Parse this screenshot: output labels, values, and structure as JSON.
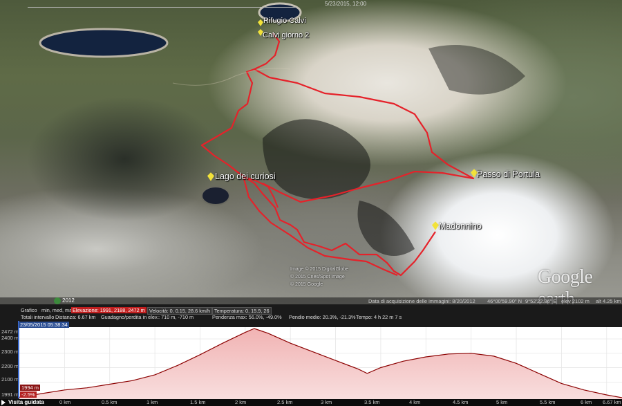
{
  "map": {
    "date": "5/23/2015, 12:00",
    "placemarks": [
      {
        "label": "Rifugio Calvi"
      },
      {
        "label": "Calvi giorno 2"
      },
      {
        "label": "Lago dei curiosi"
      },
      {
        "label": "Passo di Portula"
      },
      {
        "label": "Madonnino"
      }
    ],
    "google_logo": "Google earth",
    "attribution": [
      "Image © 2015 DigitalGlobe",
      "© 2015 Cnes/Spot Image",
      "© 2015 Google"
    ],
    "mini_year": "2012",
    "status": {
      "acquisition": "Data di acquisizione delle immagini: 8/20/2012",
      "lat": "46°00'59.90\" N",
      "lon": "9°52'22.86\" E",
      "elev": "elev  2102 m",
      "alt": "alt  4.25 km"
    },
    "route_color": "#e5222a"
  },
  "profile": {
    "row1": {
      "grafico_label": "Grafico",
      "grafico_opts": "min, med, max",
      "elevazione": "Elevazione: 1991, 2188, 2472 m",
      "velocita": "Velocità: 0, 0.15, 28.6 km/h",
      "temperatura": "Temperatura: 0, 15.9, 26"
    },
    "row2": {
      "totali": "Totali intervallo",
      "distanza": "Distanza: 6.67 km",
      "guadagno": "Guadagno/perdita in elev.: 710 m, -710 m",
      "pendenza": "Pendenza max: 56.0%, -49.0%",
      "pendio": "Pendio medio: 20.3%, -21.3%",
      "tempo": "Tempo: 4 h 22 m 7 s"
    },
    "cursor_date": "23/05/2015 05:38:34",
    "cursor_elev": "1994 m",
    "cursor_pct": "-2.5%",
    "y_ticks": [
      "2472 m",
      "2400 m",
      "2300 m",
      "2200 m",
      "2100 m",
      "1991 m"
    ],
    "x_ticks": [
      "0 km",
      "0.5 km",
      "1 km",
      "1.5 km",
      "2 km",
      "2.5 km",
      "3 km",
      "3.5 km",
      "4 km",
      "4.5 km",
      "5 km",
      "5.5 km",
      "6 km",
      "6.67 km"
    ],
    "tour_label": "Visita guidata",
    "fill_color": "#e88a8a",
    "line_color": "#8b0000"
  },
  "chart_data": {
    "type": "area",
    "xlabel": "",
    "ylabel": "",
    "x": [
      0,
      0.25,
      0.5,
      0.75,
      1.0,
      1.25,
      1.5,
      1.75,
      2.0,
      2.25,
      2.5,
      2.6,
      2.75,
      3.0,
      3.25,
      3.5,
      3.75,
      3.85,
      4.0,
      4.25,
      4.5,
      4.75,
      5.0,
      5.25,
      5.5,
      5.75,
      6.0,
      6.25,
      6.5,
      6.67
    ],
    "values": [
      1994,
      2020,
      2045,
      2060,
      2085,
      2110,
      2150,
      2215,
      2290,
      2370,
      2445,
      2472,
      2440,
      2370,
      2310,
      2250,
      2190,
      2160,
      2200,
      2245,
      2275,
      2295,
      2300,
      2280,
      2230,
      2160,
      2090,
      2045,
      2010,
      1991
    ],
    "ylim": [
      1991,
      2472
    ],
    "xlim": [
      0,
      6.67
    ],
    "grid": true
  }
}
